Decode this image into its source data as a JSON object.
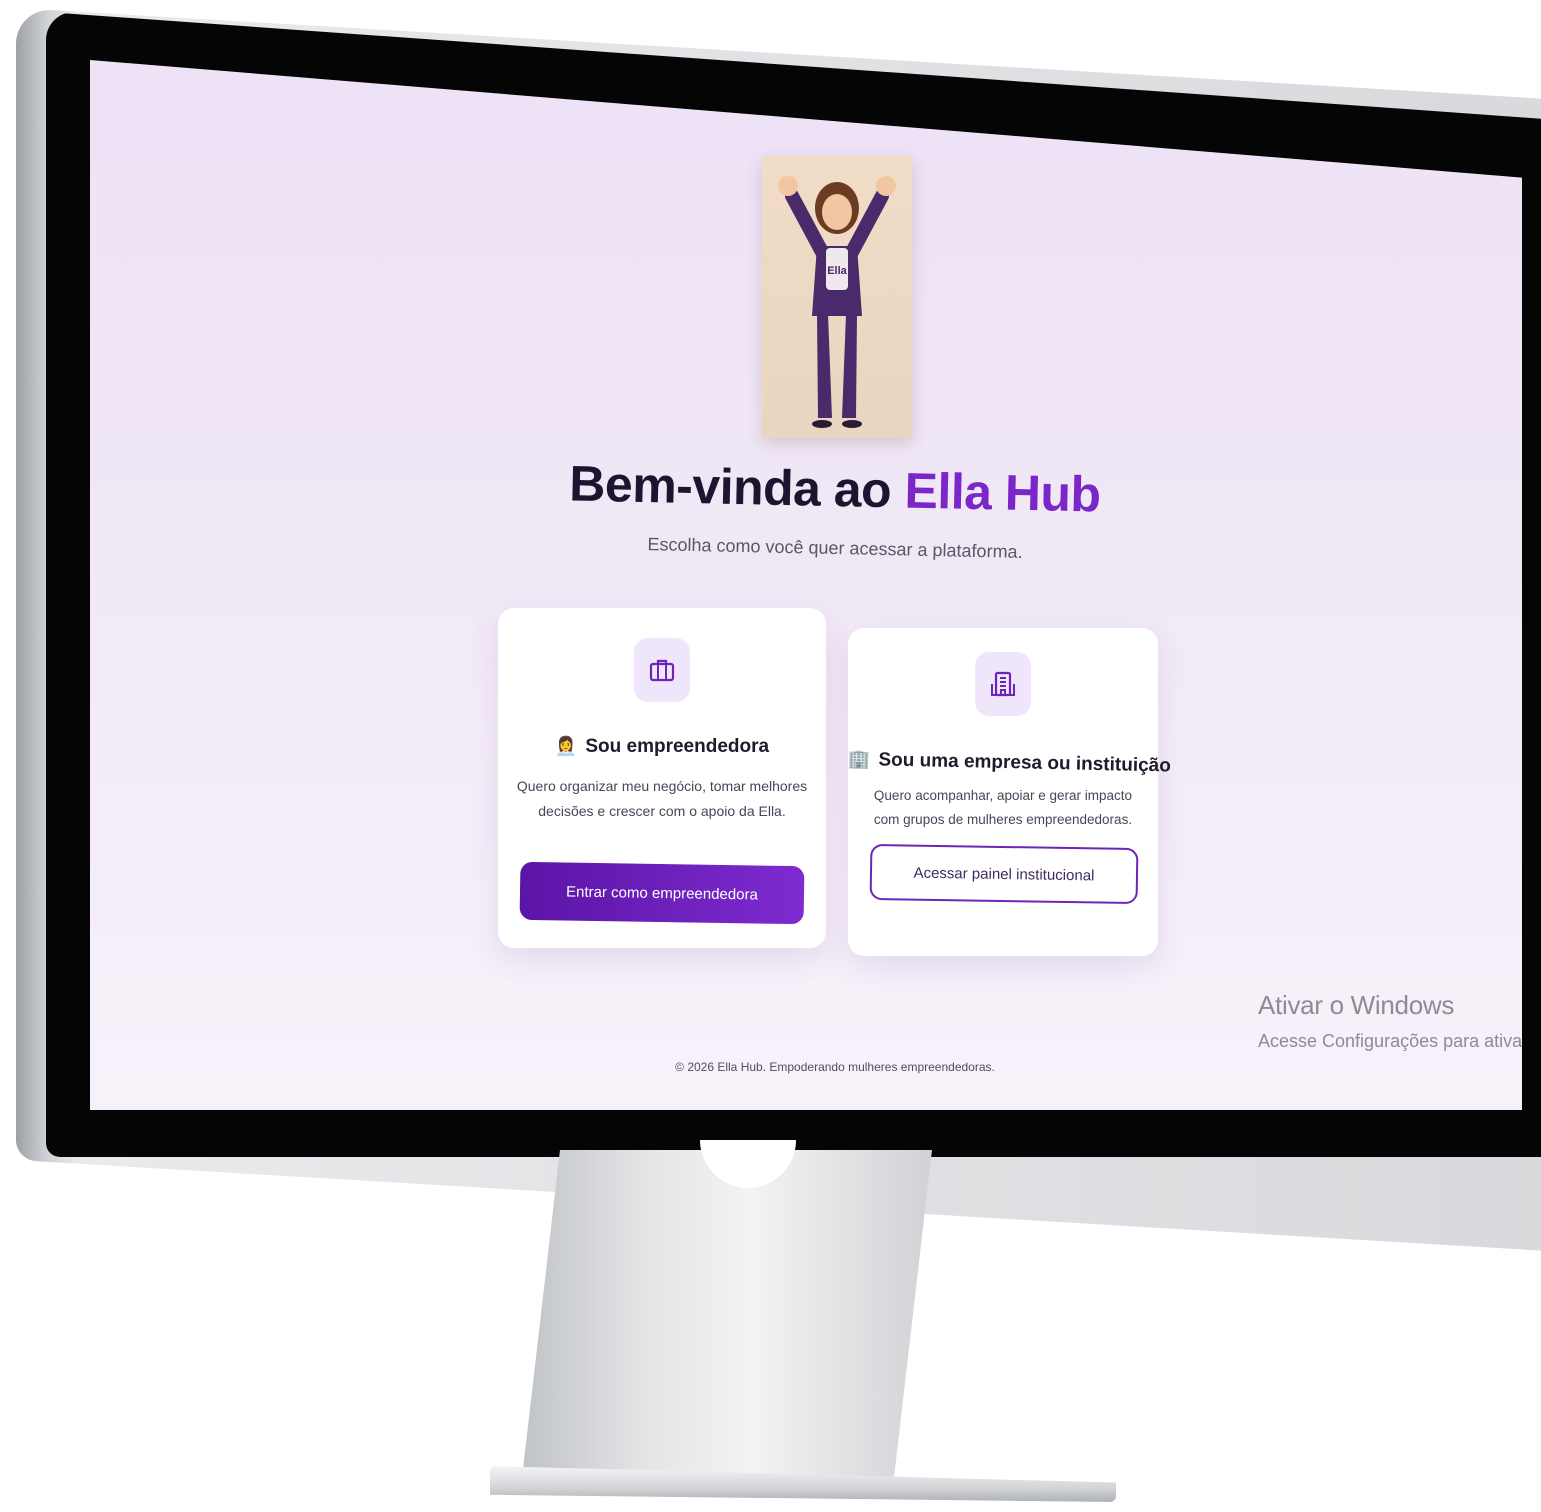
{
  "welcome": {
    "title_prefix": "Bem-vinda ao",
    "title_brand": "Ella Hub",
    "subtitle": "Escolha como você quer acessar a plataforma."
  },
  "mascot": {
    "badge": "Ella"
  },
  "cards": {
    "entrepreneur": {
      "icon": "briefcase-icon",
      "heading_emoji": "👩‍💼",
      "heading": "Sou empreendedora",
      "description": "Quero organizar meu negócio, tomar melhores decisões e crescer com o apoio da Ella.",
      "button": "Entrar como empreendedora"
    },
    "institution": {
      "icon": "building-icon",
      "heading_emoji": "🏢",
      "heading": "Sou uma empresa ou instituição",
      "description": "Quero acompanhar, apoiar e gerar impacto com grupos de mulheres empreendedoras.",
      "button": "Acessar painel institucional"
    }
  },
  "watermark": {
    "title": "Ativar o Windows",
    "subtitle": "Acesse Configurações para ativar"
  },
  "footer": {
    "text": "© 2026 Ella Hub. Empoderando mulheres empreendedoras."
  },
  "colors": {
    "brand_purple": "#7a26c9",
    "button_gradient_start": "#5b15a6",
    "button_gradient_end": "#7e2bd0",
    "page_background": "#f1e8f6"
  }
}
